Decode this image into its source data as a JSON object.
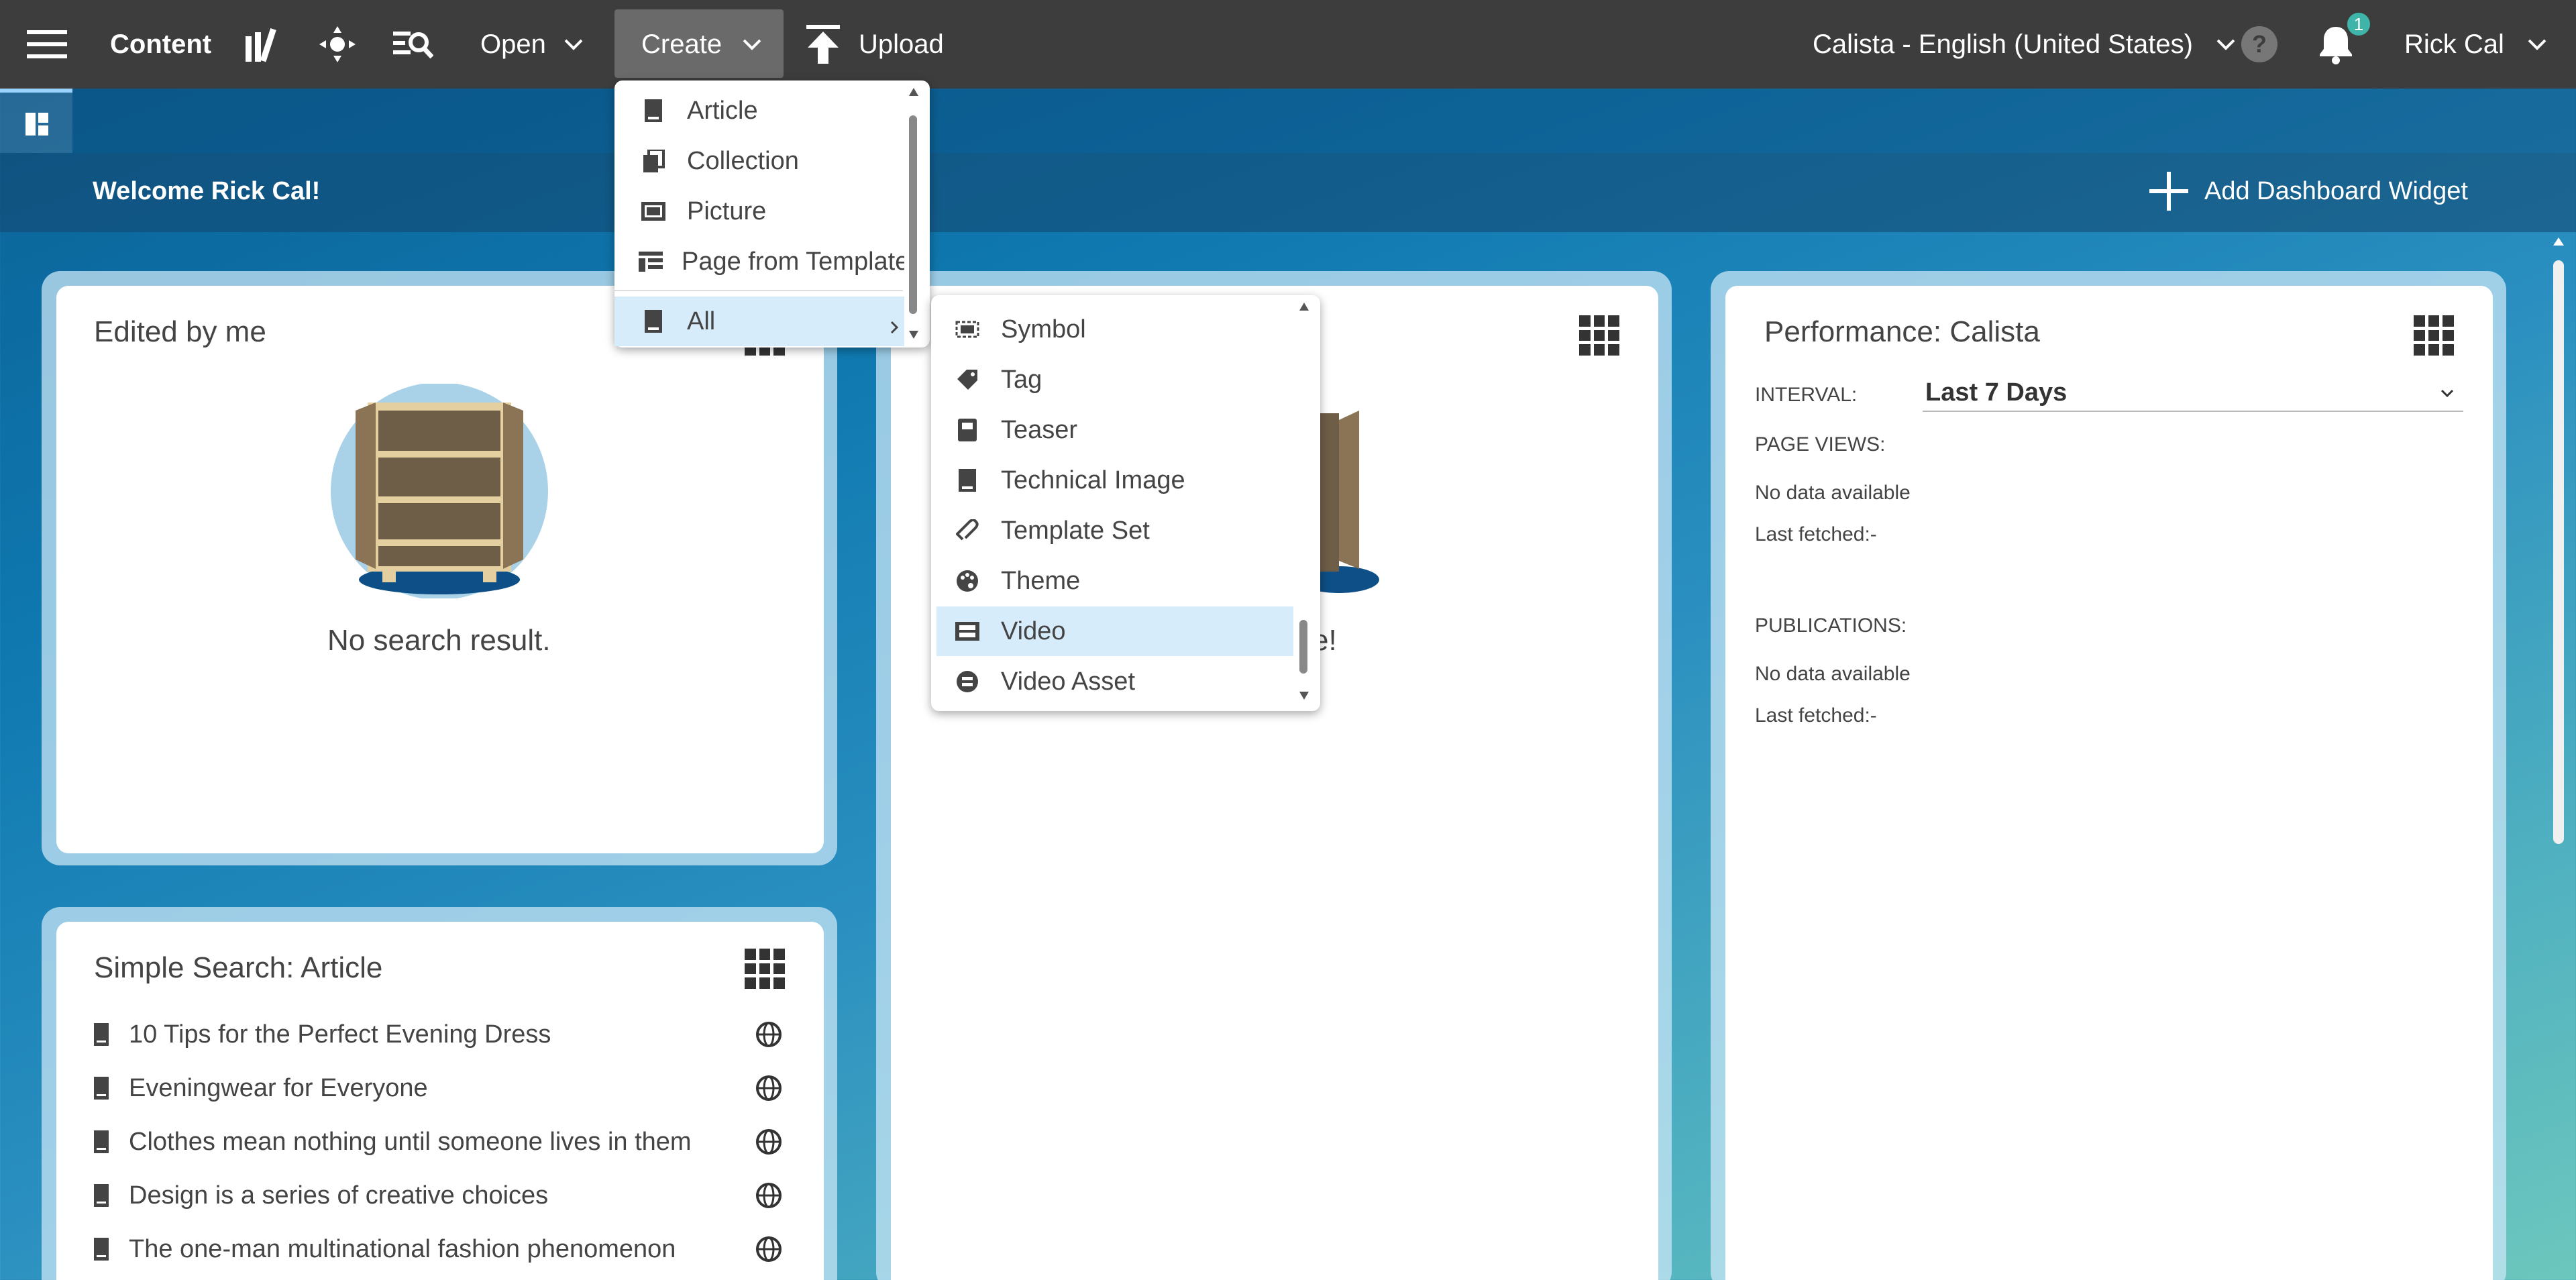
{
  "topbar": {
    "content_label": "Content",
    "open_label": "Open",
    "create_label": "Create",
    "upload_label": "Upload",
    "site_label": "Calista - English (United States)",
    "notification_count": "1",
    "user_label": "Rick Cal"
  },
  "welcome": {
    "text": "Welcome Rick Cal!",
    "add_widget_label": "Add Dashboard Widget"
  },
  "widgets": {
    "edited": {
      "title": "Edited by me",
      "empty_text": "No search result."
    },
    "middle": {
      "partial_text": "e!"
    },
    "search": {
      "title": "Simple Search: Article",
      "items": [
        "10 Tips for the Perfect Evening Dress",
        "Eveningwear for Everyone",
        "Clothes mean nothing until someone lives in them",
        "Design is a series of creative choices",
        "The one-man multinational fashion phenomenon"
      ]
    },
    "performance": {
      "title": "Performance: Calista",
      "interval_label": "INTERVAL:",
      "interval_value": "Last 7 Days",
      "page_views_label": "PAGE VIEWS:",
      "page_views_empty": "No data available",
      "page_views_fetched": "Last fetched:-",
      "publications_label": "PUBLICATIONS:",
      "publications_empty": "No data available",
      "publications_fetched": "Last fetched:-"
    }
  },
  "create_menu": {
    "items": [
      {
        "label": "Article",
        "icon": "article-icon"
      },
      {
        "label": "Collection",
        "icon": "collection-icon"
      },
      {
        "label": "Picture",
        "icon": "picture-icon"
      },
      {
        "label": "Page from Template",
        "icon": "page-template-icon"
      },
      {
        "label": "All",
        "icon": "all-icon",
        "selected": true
      }
    ]
  },
  "all_submenu": {
    "items": [
      {
        "label": "Symbol",
        "icon": "symbol-icon"
      },
      {
        "label": "Tag",
        "icon": "tag-icon"
      },
      {
        "label": "Teaser",
        "icon": "teaser-icon"
      },
      {
        "label": "Technical Image",
        "icon": "technical-image-icon"
      },
      {
        "label": "Template Set",
        "icon": "template-set-icon"
      },
      {
        "label": "Theme",
        "icon": "theme-icon"
      },
      {
        "label": "Video",
        "icon": "video-icon",
        "selected": true
      },
      {
        "label": "Video Asset",
        "icon": "video-asset-icon"
      }
    ]
  },
  "colors": {
    "topbar": "#3d3d3d",
    "selected_item": "#d6ecfb",
    "badge": "#3fb4a8"
  }
}
